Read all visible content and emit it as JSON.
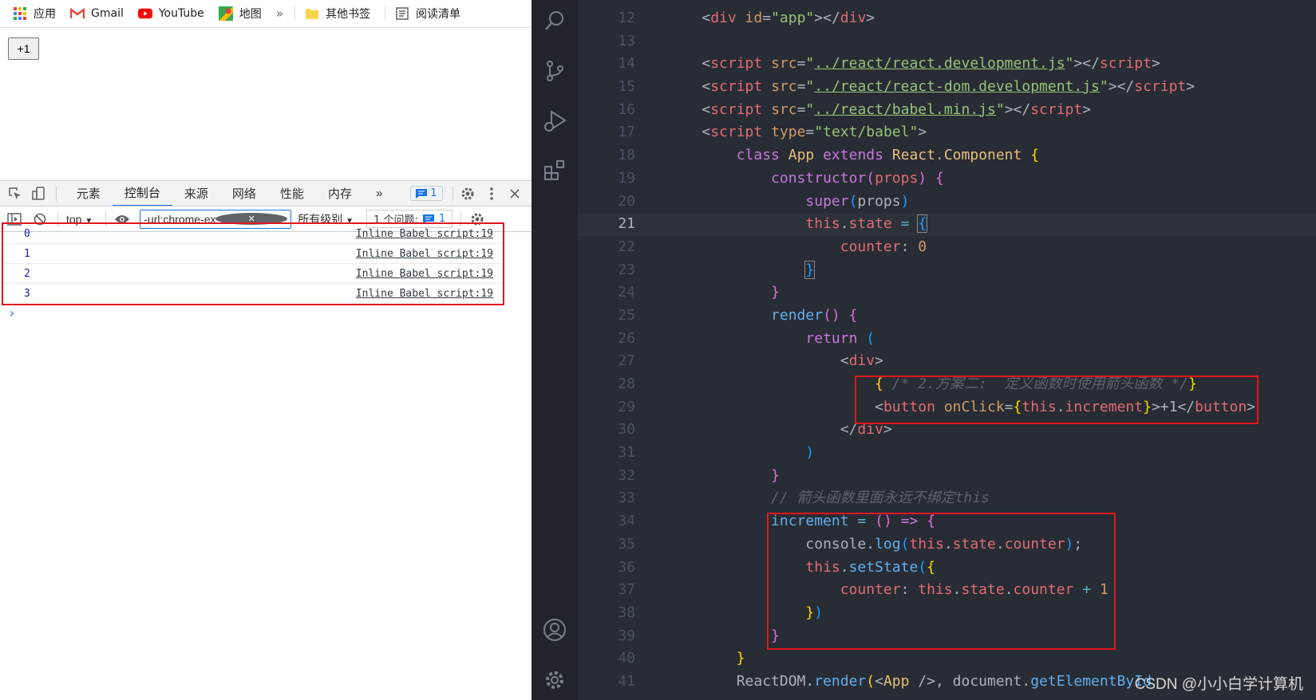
{
  "bookmarks": {
    "items": [
      {
        "label": "应用",
        "icon": "apps-grid-icon"
      },
      {
        "label": "Gmail",
        "icon": "gmail-icon"
      },
      {
        "label": "YouTube",
        "icon": "youtube-icon"
      },
      {
        "label": "地图",
        "icon": "maps-icon"
      }
    ],
    "more": "»",
    "other": "其他书签",
    "reading": "阅读清单"
  },
  "page": {
    "button_label": "+1"
  },
  "devtools": {
    "tabs": [
      "元素",
      "控制台",
      "来源",
      "网络",
      "性能",
      "内存"
    ],
    "active_tab": "控制台",
    "more_tabs": "»",
    "issue_badge": "1",
    "context": "top",
    "filter_value": "-url:chrome-extension://jg",
    "level": "所有级别",
    "issues_label": "1 个问题:",
    "issues_count": "1",
    "console_rows": [
      {
        "value": "0",
        "source": "Inline Babel script:19"
      },
      {
        "value": "1",
        "source": "Inline Babel script:19"
      },
      {
        "value": "2",
        "source": "Inline Babel script:19"
      },
      {
        "value": "3",
        "source": "Inline Babel script:19"
      }
    ],
    "prompt": "›"
  },
  "editor": {
    "current_line": 21,
    "line_numbers": [
      "12",
      "13",
      "14",
      "15",
      "16",
      "17",
      "18",
      "19",
      "20",
      "21",
      "22",
      "23",
      "24",
      "25",
      "26",
      "27",
      "28",
      "29",
      "30",
      "31",
      "32",
      "33",
      "34",
      "35",
      "36",
      "37",
      "38",
      "39",
      "40",
      "41"
    ],
    "watermark": "CSDN @小小白学计算机"
  },
  "colors": {
    "editor_bg": "#282c34",
    "highlight_box": "#e0161e",
    "devtools_accent": "#1a73e8"
  }
}
